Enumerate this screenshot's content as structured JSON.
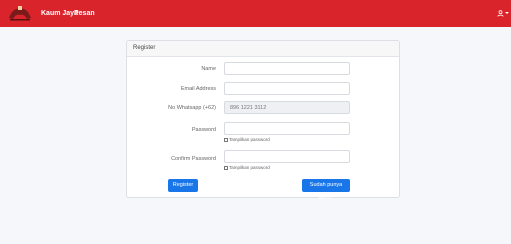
{
  "navbar": {
    "brand": "Kaum Jaya",
    "link": "Pesan",
    "user_icon": "user-icon"
  },
  "card": {
    "title": "Register",
    "fields": {
      "name": {
        "label": "Name",
        "value": ""
      },
      "email": {
        "label": "Email Address",
        "value": ""
      },
      "whatsapp": {
        "label": "No Whatsapp (+62)",
        "value": "896 1221 3112"
      },
      "password": {
        "label": "Password",
        "value": "",
        "toggle": "Tampilkan password"
      },
      "confirm": {
        "label": "Confirm Password",
        "value": "",
        "toggle": "Tampilkan password"
      }
    },
    "buttons": {
      "register": "Register",
      "login": "Sudah punya akun?"
    }
  },
  "colors": {
    "navbar": "#d9242b",
    "primary_button": "#1976e8"
  }
}
